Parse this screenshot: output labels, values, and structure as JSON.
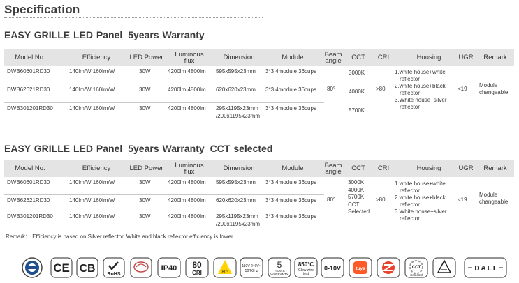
{
  "page_title": "Specification",
  "sections": [
    {
      "title_a": "EASY  GRILLE LED Panel",
      "title_b": "5years Warranty",
      "title_c": "",
      "headers": {
        "model": "Model No.",
        "efficiency": "Efficiency",
        "power": "LED Power",
        "luminous_1": "Luminous",
        "luminous_2": "flux",
        "dimension": "Dimension",
        "module": "Module",
        "beam_1": "Beam",
        "beam_2": "angle",
        "cct": "CCT",
        "cri": "CRI",
        "housing": "Housing",
        "ugr": "UGR",
        "remark": "Remark"
      },
      "rows": [
        {
          "model": "DWB60601RD30",
          "efficiency": "140lm/W  160lm/W",
          "power": "30W",
          "flux": "4200lm  4800lm",
          "dimension_1": "595x595x23mm",
          "dimension_2": "",
          "module": "3*3 4module 36cups"
        },
        {
          "model": "DWB62621RD30",
          "efficiency": "140lm/W  160lm/W",
          "power": "30W",
          "flux": "4200lm  4800lm",
          "dimension_1": "620x620x23mm",
          "dimension_2": "",
          "module": "3*3 4module 36cups"
        },
        {
          "model": "DWB301201RD30",
          "efficiency": "140lm/W  160lm/W",
          "power": "30W",
          "flux": "4200lm  4800lm",
          "dimension_1": "295x1195x23mm",
          "dimension_2": "/200x1195x23mm",
          "module": "3*3 4module 36cups"
        }
      ],
      "beam_angle": "80°",
      "cct": [
        "3000K",
        "4000K",
        "5700K"
      ],
      "cri": ">80",
      "housing": [
        "1.white house+white",
        "reflector",
        "2.white house+black",
        "reflector",
        "3.White house+silver",
        "reflector"
      ],
      "ugr": "<19",
      "remark": [
        "Module",
        "changeable"
      ]
    },
    {
      "title_a": "EASY  GRILLE LED Panel",
      "title_b": "5years Warranty",
      "title_c": "CCT selected",
      "headers": {
        "model": "Model No.",
        "efficiency": "Efficiency",
        "power": "LED Power",
        "luminous_1": "Luminous",
        "luminous_2": "flux",
        "dimension": "Dimension",
        "module": "Module",
        "beam_1": "Beam",
        "beam_2": "angle",
        "cct": "CCT",
        "cri": "CRI",
        "housing": "Housing",
        "ugr": "UGR",
        "remark": "Remark"
      },
      "rows": [
        {
          "model": "DWB60601RD30",
          "efficiency": "140lm/W  160lm/W",
          "power": "30W",
          "flux": "4200lm  4800lm",
          "dimension_1": "595x595x23mm",
          "dimension_2": "",
          "module": "3*3 4module 36cups"
        },
        {
          "model": "DWB62621RD30",
          "efficiency": "140lm/W  160lm/W",
          "power": "30W",
          "flux": "4200lm  4800lm",
          "dimension_1": "620x620x23mm",
          "dimension_2": "",
          "module": "3*3 4module 36cups"
        },
        {
          "model": "DWB301201RD30",
          "efficiency": "140lm/W  160lm/W",
          "power": "30W",
          "flux": "4200lm  4800lm",
          "dimension_1": "295x1195x23mm",
          "dimension_2": "/200x1195x23mm",
          "module": "3*3 4module 36cups"
        }
      ],
      "beam_angle": "80°",
      "cct": [
        "3000K",
        "4000K",
        "5700K",
        "CCT",
        "Selected"
      ],
      "cri": ">80",
      "housing": [
        "1.white house+white",
        "reflector",
        "2.white house+black",
        "reflector",
        "3.White house+silver",
        "reflector"
      ],
      "ugr": "<19",
      "remark": [
        "Module",
        "changeable"
      ]
    }
  ],
  "remark_note": "Remark： Efficiency is based on Silver reflector, White and black reflector efficiency is lower.",
  "certifications": {
    "ce": "CE",
    "cb": "CB",
    "rohs": "RoHS",
    "ip": "IP40",
    "cri_value": "80",
    "cri_label": "CRI",
    "beam": "80°",
    "voltage_1": "110V-240V~",
    "voltage_2": "50/60Hz",
    "warranty_years": "5",
    "warranty_label_1": "YEARS",
    "warranty_label_2": "WARRANTY",
    "glow_temp": "850°C",
    "glow_1": "Glow wire",
    "glow_2": "test",
    "dimming": "0-10V",
    "tuya": "tuya",
    "cct_label": "CCT",
    "cct_sub": "Selected",
    "dali": "DALI"
  },
  "colors": {
    "header_bg": "#e4e4e4",
    "tuya_orange": "#ff5a28",
    "beam_yellow": "#ffd200",
    "zigbee_red": "#e8432e",
    "emblem_blue": "#1f4f8f"
  }
}
